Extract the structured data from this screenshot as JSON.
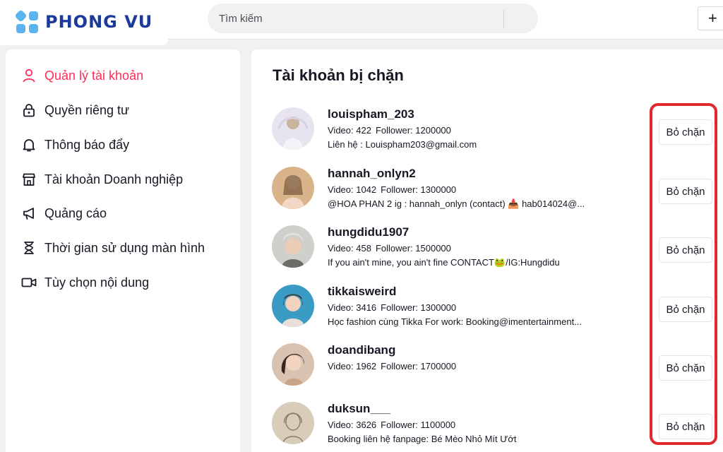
{
  "brand": {
    "name": "PHONG VU",
    "color": "#1b3a9a",
    "accent": "#5ab4f0"
  },
  "search": {
    "placeholder": "Tìm kiếm",
    "icon": "search-icon"
  },
  "header": {
    "add_button": "+"
  },
  "sidebar": {
    "items": [
      {
        "label": "Quản lý tài khoản",
        "icon": "user-icon",
        "active": true
      },
      {
        "label": "Quyền riêng tư",
        "icon": "lock-icon"
      },
      {
        "label": "Thông báo đẩy",
        "icon": "bell-icon"
      },
      {
        "label": "Tài khoản Doanh nghiệp",
        "icon": "store-icon"
      },
      {
        "label": "Quảng cáo",
        "icon": "megaphone-icon"
      },
      {
        "label": "Thời gian sử dụng màn hình",
        "icon": "hourglass-icon"
      },
      {
        "label": "Tùy chọn nội dung",
        "icon": "video-icon"
      }
    ]
  },
  "main": {
    "title": "Tài khoản bị chặn",
    "unblock_label": "Bỏ chặn",
    "accounts": [
      {
        "username": "louispham_203",
        "video": "Video: 422",
        "follower": "Follower: 1200000",
        "bio": "Liên hệ : Louispham203@gmail.com"
      },
      {
        "username": "hannah_onlyn2",
        "video": "Video: 1042",
        "follower": "Follower: 1300000",
        "bio": "@HOA PHAN 2 ig : hannah_onlyn (contact) 📥 hab014024@..."
      },
      {
        "username": "hungdidu1907",
        "video": "Video: 458",
        "follower": "Follower: 1500000",
        "bio": "If you ain't mine, you ain't fine CONTACT🐸/IG:Hungdidu"
      },
      {
        "username": "tikkaisweird",
        "video": "Video: 3416",
        "follower": "Follower: 1300000",
        "bio": "Học fashion cùng Tikka For work: Booking@imentertainment..."
      },
      {
        "username": "doandibang",
        "video": "Video: 1962",
        "follower": "Follower: 1700000",
        "bio": ""
      },
      {
        "username": "duksun___",
        "video": "Video: 3626",
        "follower": "Follower: 1100000",
        "bio": "Booking liên hệ fanpage: Bé Mèo Nhỏ Mít Ướt"
      }
    ]
  },
  "colors": {
    "active": "#fe2c55",
    "highlight": "#e0282e",
    "text": "#161823"
  }
}
